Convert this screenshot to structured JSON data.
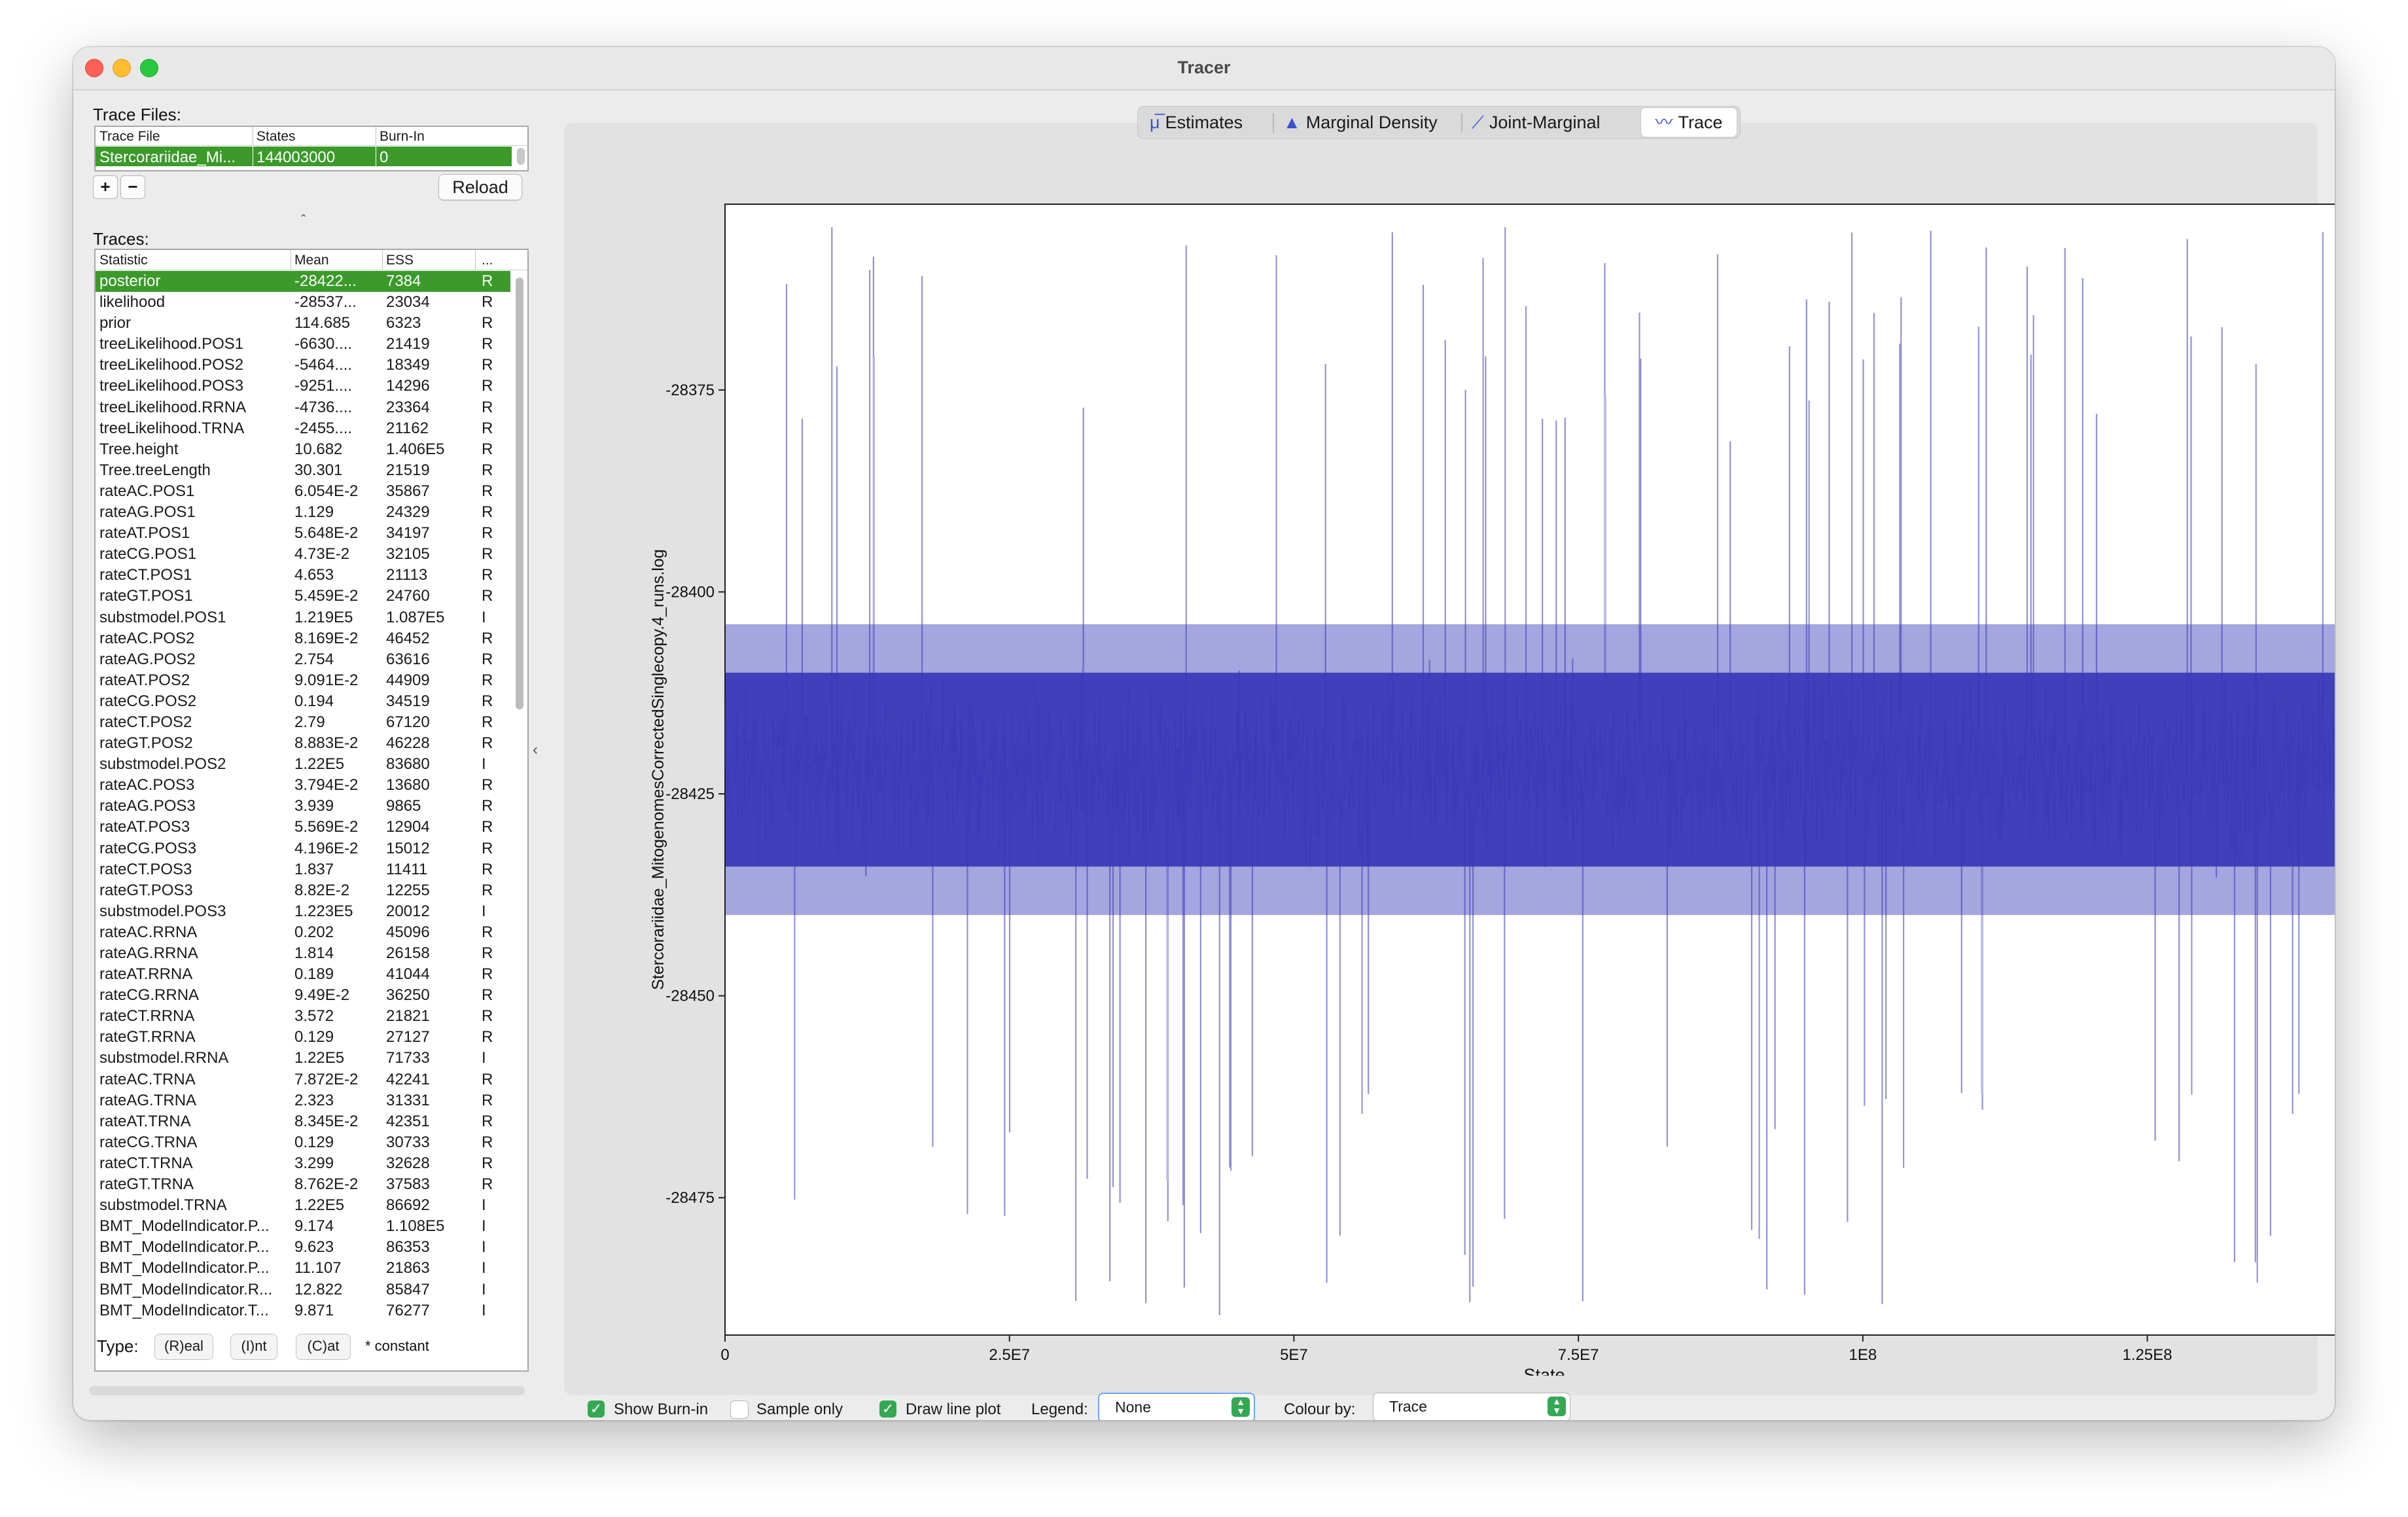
{
  "window": {
    "title": "Tracer"
  },
  "trace_files": {
    "label": "Trace Files:",
    "headers": [
      "Trace File",
      "States",
      "Burn-In"
    ],
    "row": {
      "file": "Stercorariidae_Mi...",
      "states": "144003000",
      "burnin": "0"
    },
    "add_label": "+",
    "remove_label": "−",
    "reload_label": "Reload"
  },
  "traces": {
    "label": "Traces:",
    "headers": [
      "Statistic",
      "Mean",
      "ESS",
      "..."
    ],
    "rows": [
      [
        "posterior",
        "-28422...",
        "7384",
        "R"
      ],
      [
        "likelihood",
        "-28537...",
        "23034",
        "R"
      ],
      [
        "prior",
        "114.685",
        "6323",
        "R"
      ],
      [
        "treeLikelihood.POS1",
        "-6630....",
        "21419",
        "R"
      ],
      [
        "treeLikelihood.POS2",
        "-5464....",
        "18349",
        "R"
      ],
      [
        "treeLikelihood.POS3",
        "-9251....",
        "14296",
        "R"
      ],
      [
        "treeLikelihood.RRNA",
        "-4736....",
        "23364",
        "R"
      ],
      [
        "treeLikelihood.TRNA",
        "-2455....",
        "21162",
        "R"
      ],
      [
        "Tree.height",
        "10.682",
        "1.406E5",
        "R"
      ],
      [
        "Tree.treeLength",
        "30.301",
        "21519",
        "R"
      ],
      [
        "rateAC.POS1",
        "6.054E-2",
        "35867",
        "R"
      ],
      [
        "rateAG.POS1",
        "1.129",
        "24329",
        "R"
      ],
      [
        "rateAT.POS1",
        "5.648E-2",
        "34197",
        "R"
      ],
      [
        "rateCG.POS1",
        "4.73E-2",
        "32105",
        "R"
      ],
      [
        "rateCT.POS1",
        "4.653",
        "21113",
        "R"
      ],
      [
        "rateGT.POS1",
        "5.459E-2",
        "24760",
        "R"
      ],
      [
        "substmodel.POS1",
        "1.219E5",
        "1.087E5",
        "I"
      ],
      [
        "rateAC.POS2",
        "8.169E-2",
        "46452",
        "R"
      ],
      [
        "rateAG.POS2",
        "2.754",
        "63616",
        "R"
      ],
      [
        "rateAT.POS2",
        "9.091E-2",
        "44909",
        "R"
      ],
      [
        "rateCG.POS2",
        "0.194",
        "34519",
        "R"
      ],
      [
        "rateCT.POS2",
        "2.79",
        "67120",
        "R"
      ],
      [
        "rateGT.POS2",
        "8.883E-2",
        "46228",
        "R"
      ],
      [
        "substmodel.POS2",
        "1.22E5",
        "83680",
        "I"
      ],
      [
        "rateAC.POS3",
        "3.794E-2",
        "13680",
        "R"
      ],
      [
        "rateAG.POS3",
        "3.939",
        "9865",
        "R"
      ],
      [
        "rateAT.POS3",
        "5.569E-2",
        "12904",
        "R"
      ],
      [
        "rateCG.POS3",
        "4.196E-2",
        "15012",
        "R"
      ],
      [
        "rateCT.POS3",
        "1.837",
        "11411",
        "R"
      ],
      [
        "rateGT.POS3",
        "8.82E-2",
        "12255",
        "R"
      ],
      [
        "substmodel.POS3",
        "1.223E5",
        "20012",
        "I"
      ],
      [
        "rateAC.RRNA",
        "0.202",
        "45096",
        "R"
      ],
      [
        "rateAG.RRNA",
        "1.814",
        "26158",
        "R"
      ],
      [
        "rateAT.RRNA",
        "0.189",
        "41044",
        "R"
      ],
      [
        "rateCG.RRNA",
        "9.49E-2",
        "36250",
        "R"
      ],
      [
        "rateCT.RRNA",
        "3.572",
        "21821",
        "R"
      ],
      [
        "rateGT.RRNA",
        "0.129",
        "27127",
        "R"
      ],
      [
        "substmodel.RRNA",
        "1.22E5",
        "71733",
        "I"
      ],
      [
        "rateAC.TRNA",
        "7.872E-2",
        "42241",
        "R"
      ],
      [
        "rateAG.TRNA",
        "2.323",
        "31331",
        "R"
      ],
      [
        "rateAT.TRNA",
        "8.345E-2",
        "42351",
        "R"
      ],
      [
        "rateCG.TRNA",
        "0.129",
        "30733",
        "R"
      ],
      [
        "rateCT.TRNA",
        "3.299",
        "32628",
        "R"
      ],
      [
        "rateGT.TRNA",
        "8.762E-2",
        "37583",
        "R"
      ],
      [
        "substmodel.TRNA",
        "1.22E5",
        "86692",
        "I"
      ],
      [
        "BMT_ModelIndicator.P...",
        "9.174",
        "1.108E5",
        "I"
      ],
      [
        "BMT_ModelIndicator.P...",
        "9.623",
        "86353",
        "I"
      ],
      [
        "BMT_ModelIndicator.P...",
        "11.107",
        "21863",
        "I"
      ],
      [
        "BMT_ModelIndicator.R...",
        "12.822",
        "85847",
        "I"
      ],
      [
        "BMT_ModelIndicator.T...",
        "9.871",
        "76277",
        "I"
      ]
    ],
    "selected_index": 0
  },
  "type_bar": {
    "label": "Type:",
    "real": "(R)eal",
    "int": "(I)nt",
    "cat": "(C)at",
    "constant": "* constant"
  },
  "tabs": [
    {
      "label": "Estimates",
      "icon": "mean-icon"
    },
    {
      "label": "Marginal Density",
      "icon": "density-icon"
    },
    {
      "label": "Joint-Marginal",
      "icon": "joint-marginal-icon"
    },
    {
      "label": "Trace",
      "icon": "trace-icon",
      "active": true
    }
  ],
  "chart_data": {
    "type": "line",
    "title": "",
    "xlabel": "State",
    "ylabel": "Stercorariidae_MitogenomesCorrectedSinglecopy.4_runs.log",
    "xlim": [
      0,
      144003000
    ],
    "ylim": [
      -28492,
      -28352
    ],
    "x_ticks": [
      0,
      25000000,
      50000000,
      75000000,
      100000000,
      125000000
    ],
    "x_tick_labels": [
      "0",
      "2.5E7",
      "5E7",
      "7.5E7",
      "1E8",
      "1.25E8"
    ],
    "y_ticks": [
      -28375,
      -28400,
      -28425,
      -28450,
      -28475
    ],
    "y_tick_labels": [
      "-28375",
      "-28400",
      "-28425",
      "-28450",
      "-28475"
    ],
    "series": [
      {
        "mean": -28422,
        "core_band": [
          -28434,
          -28410
        ],
        "range": [
          -28491,
          -28353
        ],
        "color": "#3838b8"
      }
    ]
  },
  "controls": {
    "show_burnin": {
      "label": "Show Burn-in",
      "checked": true
    },
    "sample_only": {
      "label": "Sample only",
      "checked": false
    },
    "draw_line_plot": {
      "label": "Draw line plot",
      "checked": true
    },
    "legend_label": "Legend:",
    "legend_value": "None",
    "colour_by_label": "Colour by:",
    "colour_by_value": "Trace"
  },
  "colors": {
    "accent": "#3b9a2a",
    "trace": "#3838b8",
    "checkbox": "#34a853"
  }
}
